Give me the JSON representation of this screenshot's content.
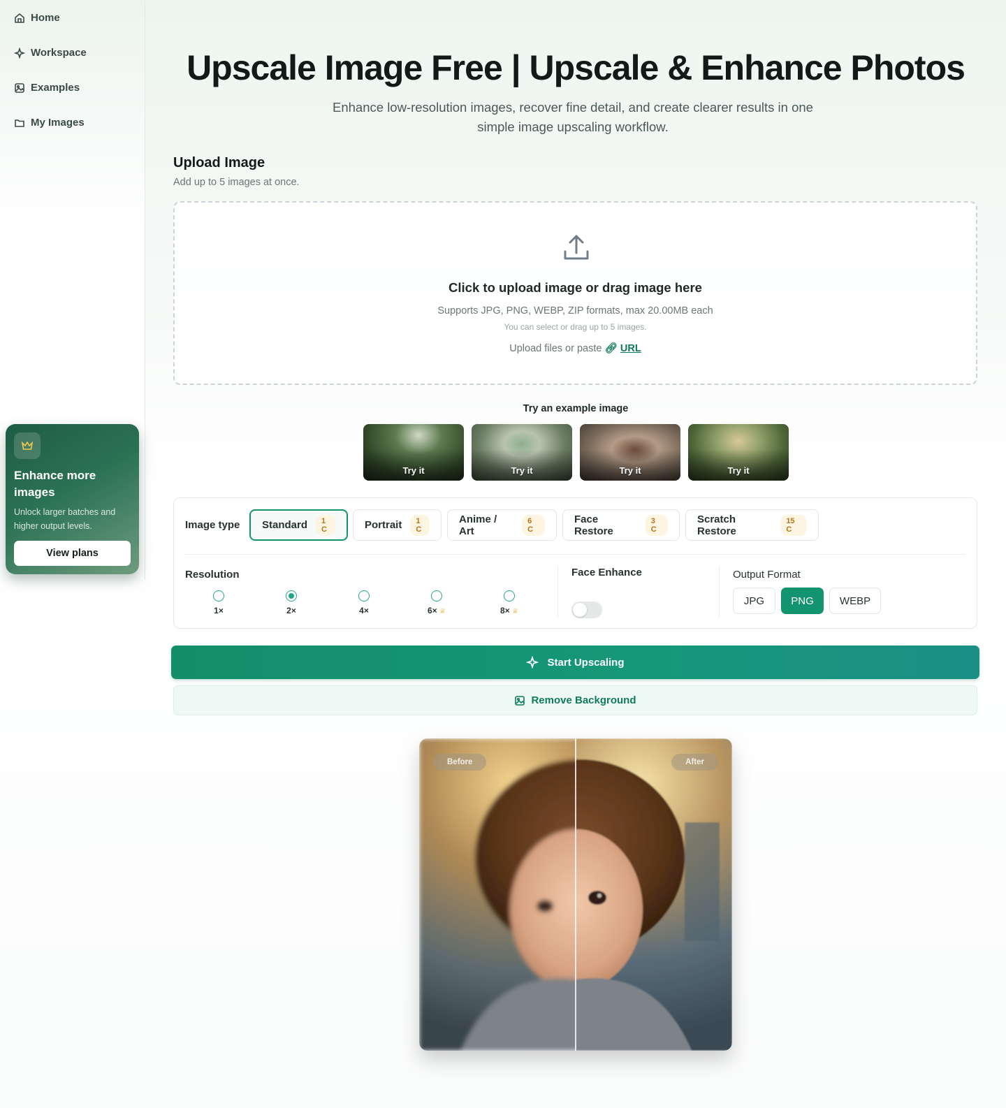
{
  "sidebar": {
    "items": [
      {
        "label": "Home",
        "icon": "home-icon"
      },
      {
        "label": "Workspace",
        "icon": "sparkle-icon"
      },
      {
        "label": "Examples",
        "icon": "gallery-icon"
      },
      {
        "label": "My Images",
        "icon": "folder-icon"
      }
    ],
    "promo": {
      "icon": "crown-icon",
      "title": "Enhance more images",
      "subtitle": "Unlock larger batches and higher output levels.",
      "button": "View plans"
    }
  },
  "header": {
    "title": "Upscale Image Free | Upscale & Enhance Photos",
    "subtitle": "Enhance low-resolution images, recover fine detail, and create clearer results in one simple image upscaling workflow."
  },
  "upload": {
    "heading": "Upload Image",
    "subheading": "Add up to 5 images at once.",
    "icon": "upload-icon",
    "title": "Click to upload image or drag image here",
    "formats": "Supports JPG, PNG, WEBP, ZIP formats, max 20.00MB each",
    "note": "You can select or drag up to 5 images.",
    "paste_text": "Upload files or paste",
    "url_label": "URL"
  },
  "examples": {
    "title": "Try an example image",
    "items": [
      {
        "label": "Try it"
      },
      {
        "label": "Try it"
      },
      {
        "label": "Try it"
      },
      {
        "label": "Try it"
      }
    ]
  },
  "settings": {
    "image_type_label": "Image type",
    "image_types": [
      {
        "label": "Standard",
        "cost": "1 C",
        "selected": true
      },
      {
        "label": "Portrait",
        "cost": "1 C",
        "selected": false
      },
      {
        "label": "Anime / Art",
        "cost": "6 C",
        "selected": false
      },
      {
        "label": "Face Restore",
        "cost": "3 C",
        "selected": false
      },
      {
        "label": "Scratch Restore",
        "cost": "15 C",
        "selected": false
      }
    ],
    "resolution_label": "Resolution",
    "resolutions": [
      {
        "label": "1×",
        "premium": false,
        "selected": false
      },
      {
        "label": "2×",
        "premium": false,
        "selected": true
      },
      {
        "label": "4×",
        "premium": false,
        "selected": false
      },
      {
        "label": "6×",
        "premium": true,
        "selected": false
      },
      {
        "label": "8×",
        "premium": true,
        "selected": false
      }
    ],
    "face_enhance_label": "Face Enhance",
    "face_enhance_on": false,
    "output_format_label": "Output Format",
    "formats": [
      {
        "label": "JPG",
        "selected": false
      },
      {
        "label": "PNG",
        "selected": true
      },
      {
        "label": "WEBP",
        "selected": false
      }
    ]
  },
  "actions": {
    "start": "Start Upscaling",
    "remove_bg": "Remove Background"
  },
  "comparison": {
    "before_label": "Before",
    "after_label": "After"
  },
  "colors": {
    "accent": "#14936f",
    "accent_light": "#eef9f5",
    "badge_bg": "#fdf4e1",
    "badge_text": "#b4761a"
  }
}
